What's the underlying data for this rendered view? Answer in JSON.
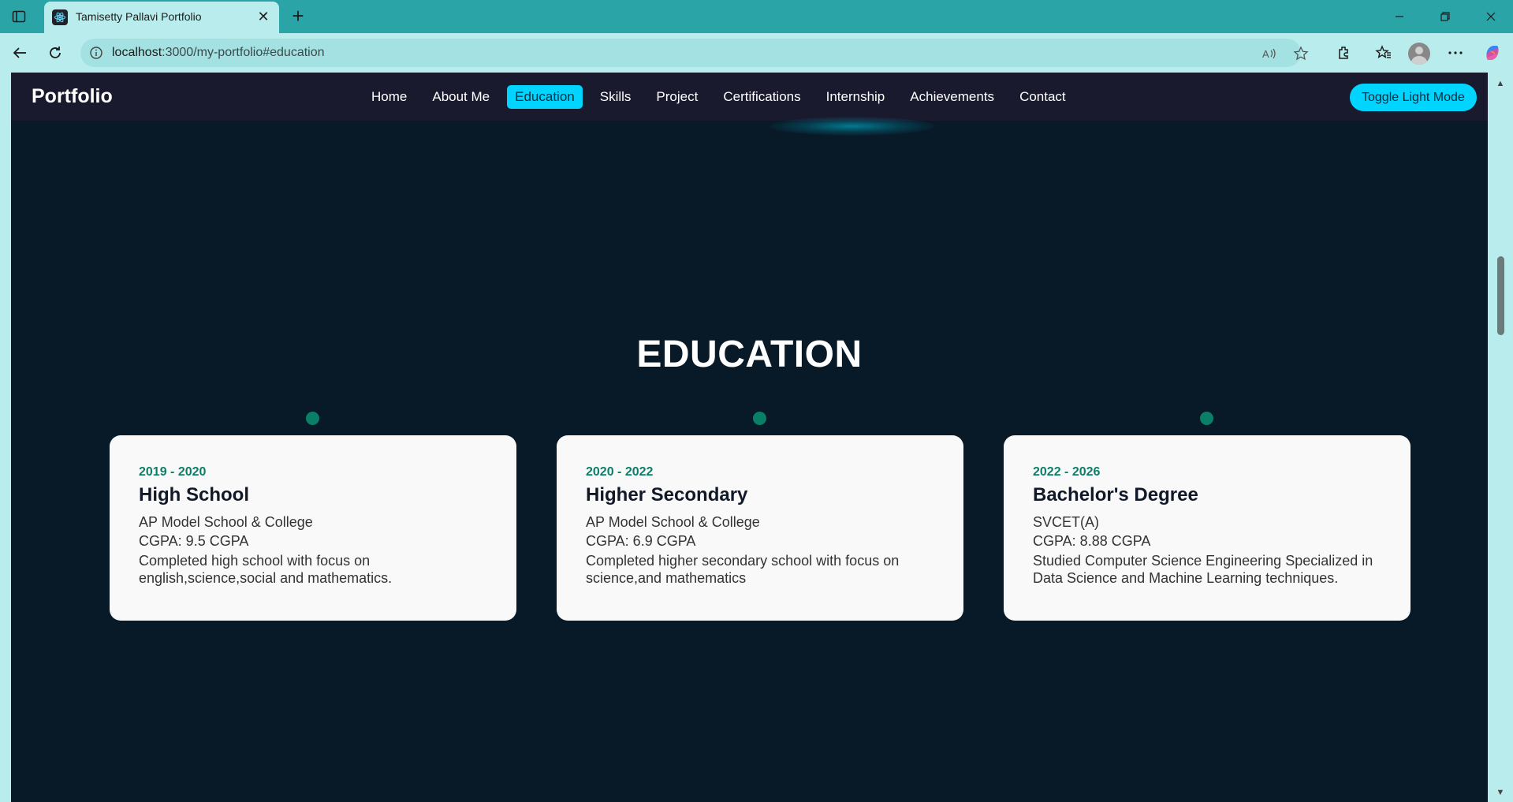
{
  "browser": {
    "tab_title": "Tamisetty Pallavi Portfolio",
    "tab_close": "✕",
    "new_tab": "+",
    "url_host": "localhost",
    "url_rest": ":3000/my-portfolio#education"
  },
  "site": {
    "brand": "Portfolio",
    "nav": [
      {
        "label": "Home"
      },
      {
        "label": "About Me"
      },
      {
        "label": "Education",
        "active": true
      },
      {
        "label": "Skills"
      },
      {
        "label": "Project"
      },
      {
        "label": "Certifications"
      },
      {
        "label": "Internship"
      },
      {
        "label": "Achievements"
      },
      {
        "label": "Contact"
      }
    ],
    "toggle_label": "Toggle Light Mode"
  },
  "education": {
    "title": "EDUCATION",
    "cards": [
      {
        "years": "2019 - 2020",
        "degree": "High School",
        "institution": "AP Model School & College",
        "score": "CGPA: 9.5 CGPA",
        "description": "Completed high school with focus on english,science,social and mathematics."
      },
      {
        "years": "2020 - 2022",
        "degree": "Higher Secondary",
        "institution": "AP Model School & College",
        "score": "CGPA: 6.9 CGPA",
        "description": "Completed higher secondary school with focus on science,and mathematics"
      },
      {
        "years": "2022 - 2026",
        "degree": "Bachelor's Degree",
        "institution": "SVCET(A)",
        "score": "CGPA: 8.88 CGPA",
        "description": "Studied Computer Science Engineering Specialized in Data Science and Machine Learning techniques."
      }
    ]
  },
  "colors": {
    "page_bg": "#081a27",
    "nav_bg": "#1a1a2e",
    "accent": "#00d4ff",
    "timeline": "#0a7f67",
    "card_bg": "#f9f9f9",
    "browser_chrome": "#2ba4a8"
  }
}
